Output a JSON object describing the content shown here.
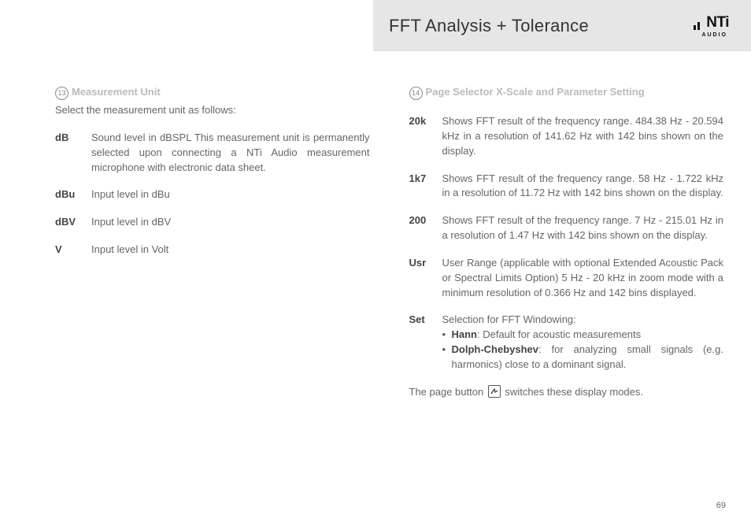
{
  "header": {
    "title": "FFT Analysis + Tolerance",
    "logo_brand": "NTi",
    "logo_sub": "AUDIO"
  },
  "left": {
    "num": "13",
    "heading": "Measurement Unit",
    "intro": "Select the measurement unit as follows:",
    "items": [
      {
        "term": "dB",
        "desc": "Sound level in dBSPL\nThis measurement unit is permanently selected upon connecting a NTi Audio measurement microphone with electronic data sheet."
      },
      {
        "term": "dBu",
        "desc": "Input level in dBu"
      },
      {
        "term": "dBV",
        "desc": "Input level in dBV"
      },
      {
        "term": "V",
        "desc": "Input level in Volt"
      }
    ]
  },
  "right": {
    "num": "14",
    "heading": "Page Selector X-Scale and Parameter Setting",
    "items": [
      {
        "term": "20k",
        "desc": "Shows FFT result of the frequency range.\n484.38 Hz - 20.594 kHz in a resolution of 141.62 Hz with 142 bins shown on the display."
      },
      {
        "term": "1k7",
        "desc": "Shows FFT result of the frequency range.\n58 Hz - 1.722 kHz in a resolution of 11.72 Hz with 142 bins shown on the display."
      },
      {
        "term": "200",
        "desc": "Shows FFT result of the frequency range.\n7 Hz - 215.01 Hz in a resolution of 1.47 Hz with 142 bins shown on the display."
      },
      {
        "term": "Usr",
        "desc": "User Range\n(applicable with optional Extended Acoustic Pack or Spectral Limits Option)\n5 Hz - 20 kHz in zoom mode with a minimum resolution of 0.366 Hz and 142 bins displayed."
      }
    ],
    "set": {
      "term": "Set",
      "lead": "Selection for FFT Windowing:",
      "bullets": [
        {
          "b": "Hann",
          "rest": ": Default for acoustic measurements"
        },
        {
          "b": "Dolph-Chebyshev",
          "rest": ": for analyzing small signals (e.g. harmonics) close to a dominant signal."
        }
      ]
    },
    "footer_a": "The page button ",
    "footer_b": " switches these display modes."
  },
  "page_number": "69"
}
